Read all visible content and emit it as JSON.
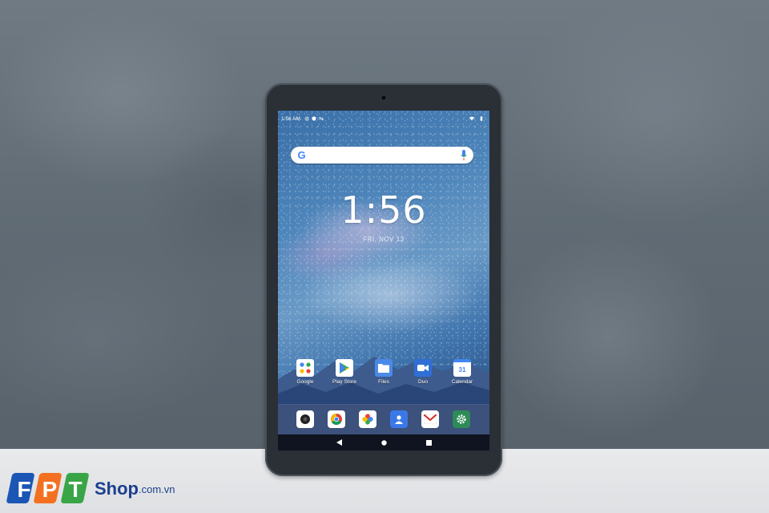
{
  "brand": {
    "logo_letters": "FPT",
    "word": "Shop",
    "suffix": ".com.vn",
    "colors": {
      "f": "#1b56b4",
      "p": "#f37021",
      "t": "#3aa547",
      "text": "#1b3f8f"
    }
  },
  "tablet": {
    "status_bar": {
      "time": "1:56 AM",
      "icons": [
        "gear-icon",
        "shield-icon",
        "n-icon",
        "wifi-icon",
        "battery-icon"
      ]
    },
    "search": {
      "logo": "G",
      "mic_icon": "mic-icon"
    },
    "clock": {
      "time": "1:56",
      "date": "FRI, NOV 13"
    },
    "apps": [
      {
        "label": "Google",
        "icon": "google-folder-icon",
        "color": "#ffffff"
      },
      {
        "label": "Play Store",
        "icon": "play-store-icon",
        "color": "#ffffff"
      },
      {
        "label": "Files",
        "icon": "files-icon",
        "color": "#4a89e8"
      },
      {
        "label": "Duo",
        "icon": "duo-icon",
        "color": "#2f6fd6"
      },
      {
        "label": "Calendar",
        "icon": "calendar-icon",
        "color": "#ffffff",
        "day": "31"
      }
    ],
    "dock": [
      {
        "icon": "camera-icon",
        "color": "#ffffff"
      },
      {
        "icon": "chrome-icon",
        "color": "#ffffff"
      },
      {
        "icon": "photos-icon",
        "color": "#ffffff"
      },
      {
        "icon": "contacts-icon",
        "color": "#3b78e7"
      },
      {
        "icon": "gmail-icon",
        "color": "#ffffff"
      },
      {
        "icon": "settings-icon",
        "color": "#2e8b57"
      }
    ],
    "nav": [
      "back-icon",
      "home-icon",
      "recents-icon"
    ]
  }
}
